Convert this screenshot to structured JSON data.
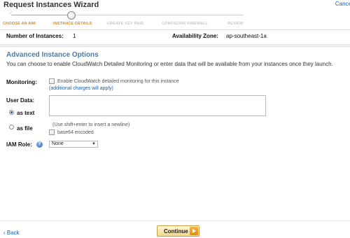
{
  "window": {
    "title": "Request Instances Wizard",
    "cancel_label": "Cance"
  },
  "wizard": {
    "steps": [
      {
        "label": "CHOOSE AN AMI",
        "state": "done"
      },
      {
        "label": "INSTANCE DETAILS",
        "state": "current"
      },
      {
        "label": "CREATE KEY PAIR",
        "state": "upcoming"
      },
      {
        "label": "CONFIGURE FIREWALL",
        "state": "upcoming"
      },
      {
        "label": "REVIEW",
        "state": "upcoming"
      }
    ]
  },
  "summary": {
    "instances_label": "Number of Instances:",
    "instances_value": "1",
    "zone_label": "Availability Zone:",
    "zone_value": "ap-southeast-1a"
  },
  "advanced": {
    "title": "Advanced Instance Options",
    "description": "You can choose to enable CloudWatch Detailed Monitoring or enter data that will be available from your instances once they launch.",
    "monitoring": {
      "label": "Monitoring:",
      "checkbox_label": "Enable CloudWatch detailed monitoring for this instance",
      "charges_link": "(additional charges will apply)",
      "checked": false
    },
    "user_data": {
      "label": "User Data:",
      "value": "",
      "as_text_label": "as text",
      "as_file_label": "as file",
      "selected": "as text",
      "hint": "(Use shift+enter to insert a newline)",
      "base64_label": "base64 encoded",
      "base64_checked": false
    },
    "iam_role": {
      "label": "IAM Role:",
      "selected": "None"
    }
  },
  "footer": {
    "back_label": "Back",
    "continue_label": "Continue"
  },
  "colors": {
    "accent": "#d08a2c",
    "link": "#1a5fa8",
    "section_title": "#4f7a9f"
  }
}
